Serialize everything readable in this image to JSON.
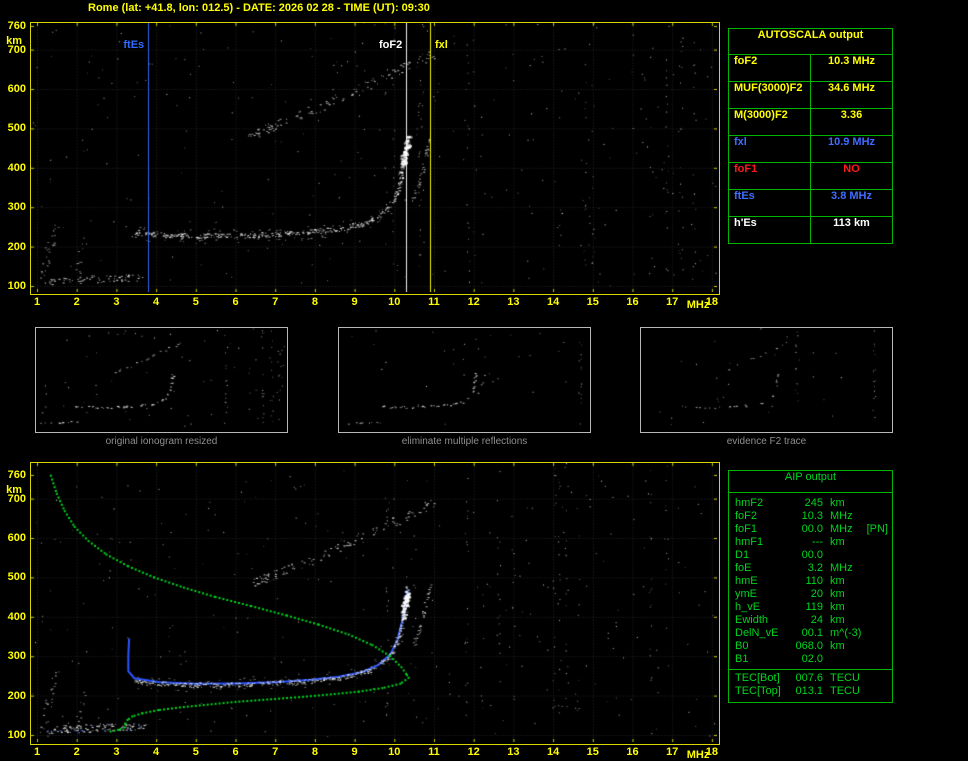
{
  "header": {
    "title": "Rome (lat: +41.8, lon: 012.5) - DATE: 2026 02 28 - TIME (UT): 09:30"
  },
  "autoscala_table": {
    "title": "AUTOSCALA output",
    "rows": [
      {
        "label": "foF2",
        "value": "10.3 MHz",
        "color": "#ffff00"
      },
      {
        "label": "MUF(3000)F2",
        "value": "34.6 MHz",
        "color": "#ffff00"
      },
      {
        "label": "M(3000)F2",
        "value": "3.36",
        "color": "#ffff00"
      },
      {
        "label": "fxl",
        "value": "10.9 MHz",
        "color": "#3f6dff"
      },
      {
        "label": "foF1",
        "value": "NO",
        "color": "#ff1a1a"
      },
      {
        "label": "ftEs",
        "value": "3.8 MHz",
        "color": "#3f6dff"
      },
      {
        "label": "h'Es",
        "value": "113   km",
        "color": "#ffffff"
      }
    ]
  },
  "aip_table": {
    "title": "AIP output",
    "rows": [
      {
        "label": "hmF2",
        "value": "245",
        "unit": "km",
        "note": ""
      },
      {
        "label": "foF2",
        "value": "10.3",
        "unit": "MHz",
        "note": ""
      },
      {
        "label": "foF1",
        "value": "00.0",
        "unit": "MHz",
        "note": "[PN]"
      },
      {
        "label": "hmF1",
        "value": "---",
        "unit": "km",
        "note": ""
      },
      {
        "label": "D1",
        "value": "00.0",
        "unit": "",
        "note": ""
      },
      {
        "label": "foE",
        "value": "3.2",
        "unit": "MHz",
        "note": ""
      },
      {
        "label": "hmE",
        "value": "110",
        "unit": "km",
        "note": ""
      },
      {
        "label": "ymE",
        "value": "20",
        "unit": "km",
        "note": ""
      },
      {
        "label": "h_vE",
        "value": "119",
        "unit": "km",
        "note": ""
      },
      {
        "label": "Ewidth",
        "value": "24",
        "unit": "km",
        "note": ""
      },
      {
        "label": "DelN_vE",
        "value": "00.1",
        "unit": "m^(-3)",
        "note": ""
      },
      {
        "label": "B0",
        "value": "068.0",
        "unit": "km",
        "note": ""
      },
      {
        "label": "B1",
        "value": "02.0",
        "unit": "",
        "note": ""
      }
    ],
    "tec_rows": [
      {
        "label": "TEC[Bot]",
        "value": "007.6",
        "unit": "TECU",
        "note": ""
      },
      {
        "label": "TEC[Top]",
        "value": "013.1",
        "unit": "TECU",
        "note": ""
      }
    ]
  },
  "thumbnails": [
    {
      "caption": "original ionogram resized"
    },
    {
      "caption": "eliminate multiple reflections"
    },
    {
      "caption": "evidence F2 trace"
    }
  ],
  "chart_data": {
    "type": "scatter",
    "description": "Ionogram: virtual height (km) vs sounding frequency (MHz), two large panels plus three processing thumbnails",
    "x_axis": {
      "label": "MHz",
      "min": 1,
      "max": 18,
      "ticks": [
        1,
        2,
        3,
        4,
        5,
        6,
        7,
        8,
        9,
        10,
        11,
        12,
        13,
        14,
        15,
        16,
        17,
        18
      ]
    },
    "y_axis": {
      "label": "km",
      "min": 100,
      "max": 760,
      "ticks": [
        760,
        700,
        600,
        500,
        400,
        300,
        200,
        100
      ]
    },
    "markers": [
      {
        "label": "ftEs",
        "freq": 3.8,
        "color": "#2f6bff",
        "side": "left"
      },
      {
        "label": "foF2",
        "freq": 10.3,
        "color": "#ffffff",
        "side": "left"
      },
      {
        "label": "fxl",
        "freq": 10.9,
        "color": "#ffff00",
        "side": "right"
      }
    ],
    "traces": {
      "f_trace": [
        [
          3.45,
          237
        ],
        [
          4.1,
          230
        ],
        [
          5.0,
          227
        ],
        [
          6.0,
          228
        ],
        [
          7.0,
          232
        ],
        [
          7.9,
          238
        ],
        [
          8.6,
          246
        ],
        [
          9.2,
          258
        ],
        [
          9.6,
          276
        ],
        [
          9.9,
          302
        ],
        [
          10.08,
          340
        ],
        [
          10.2,
          388
        ],
        [
          10.28,
          436
        ],
        [
          10.34,
          472
        ]
      ],
      "cusp": [
        [
          10.16,
          400
        ],
        [
          10.26,
          440
        ],
        [
          10.33,
          472
        ]
      ],
      "x_rise": [
        [
          10.45,
          320
        ],
        [
          10.6,
          360
        ],
        [
          10.72,
          405
        ],
        [
          10.82,
          450
        ],
        [
          10.88,
          478
        ]
      ],
      "upper_band": [
        [
          6.35,
          482
        ],
        [
          7.1,
          512
        ],
        [
          7.9,
          546
        ],
        [
          8.7,
          582
        ],
        [
          9.5,
          618
        ],
        [
          10.2,
          652
        ],
        [
          10.75,
          678
        ],
        [
          11.05,
          692
        ]
      ],
      "upper_blob": [
        [
          6.4,
          486
        ],
        [
          6.9,
          505
        ]
      ],
      "es_cluster": [
        [
          1.25,
          112
        ],
        [
          1.9,
          116
        ],
        [
          2.6,
          119
        ],
        [
          3.2,
          121
        ],
        [
          3.7,
          122
        ]
      ],
      "left_clutter": [
        [
          1.15,
          108
        ],
        [
          1.2,
          150
        ],
        [
          1.28,
          195
        ],
        [
          1.38,
          232
        ],
        [
          1.5,
          258
        ]
      ],
      "left_clutter2": [
        [
          2.0,
          118
        ],
        [
          2.08,
          175
        ],
        [
          2.2,
          215
        ]
      ]
    },
    "green_profile": [
      [
        1.35,
        758
      ],
      [
        1.5,
        712
      ],
      [
        1.7,
        668
      ],
      [
        1.95,
        628
      ],
      [
        2.3,
        592
      ],
      [
        2.75,
        558
      ],
      [
        3.3,
        528
      ],
      [
        3.95,
        500
      ],
      [
        4.7,
        474
      ],
      [
        5.5,
        450
      ],
      [
        6.4,
        427
      ],
      [
        7.3,
        403
      ],
      [
        8.1,
        380
      ],
      [
        8.85,
        355
      ],
      [
        9.45,
        328
      ],
      [
        9.9,
        300
      ],
      [
        10.18,
        272
      ],
      [
        10.32,
        252
      ],
      [
        10.36,
        245
      ],
      [
        10.15,
        230
      ],
      [
        9.7,
        219
      ],
      [
        9.1,
        210
      ],
      [
        8.4,
        203
      ],
      [
        7.6,
        196
      ],
      [
        6.8,
        190
      ],
      [
        6.0,
        184
      ],
      [
        5.3,
        177
      ],
      [
        4.6,
        170
      ],
      [
        4.05,
        163
      ],
      [
        3.65,
        155
      ],
      [
        3.4,
        147
      ],
      [
        3.28,
        138
      ],
      [
        3.22,
        128
      ],
      [
        3.2,
        119
      ],
      [
        3.05,
        113
      ],
      [
        2.85,
        109
      ]
    ],
    "blue_trace": [
      [
        3.32,
        345
      ],
      [
        3.3,
        300
      ],
      [
        3.3,
        262
      ],
      [
        3.45,
        244
      ],
      [
        4.1,
        234
      ],
      [
        5.0,
        230
      ],
      [
        6.0,
        231
      ],
      [
        7.0,
        234
      ],
      [
        7.9,
        240
      ],
      [
        8.6,
        248
      ],
      [
        9.2,
        260
      ],
      [
        9.6,
        278
      ],
      [
        9.9,
        304
      ],
      [
        10.08,
        342
      ],
      [
        10.2,
        390
      ],
      [
        10.28,
        438
      ],
      [
        10.33,
        468
      ]
    ]
  }
}
